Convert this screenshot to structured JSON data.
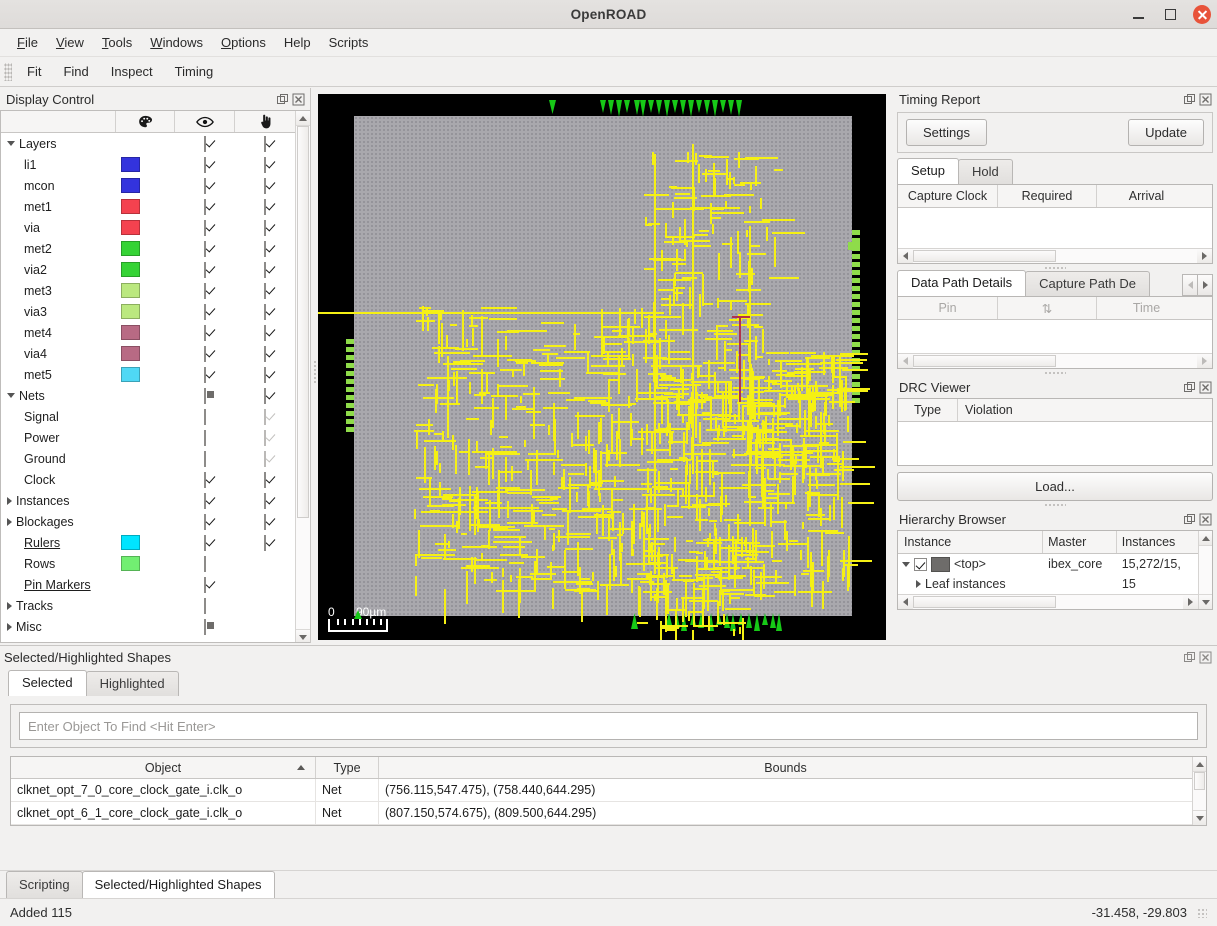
{
  "window": {
    "title": "OpenROAD",
    "minimize_label": "Minimize",
    "maximize_label": "Maximize",
    "close_label": "Close"
  },
  "menubar": {
    "items": [
      {
        "label": "File",
        "mnemonic": "F"
      },
      {
        "label": "View",
        "mnemonic": "V"
      },
      {
        "label": "Tools",
        "mnemonic": "T"
      },
      {
        "label": "Windows",
        "mnemonic": "W"
      },
      {
        "label": "Options",
        "mnemonic": "O"
      },
      {
        "label": "Help",
        "mnemonic": "H"
      },
      {
        "label": "Scripts",
        "mnemonic": ""
      }
    ]
  },
  "toolbar": {
    "items": [
      "Fit",
      "Find",
      "Inspect",
      "Timing"
    ]
  },
  "display_control": {
    "title": "Display Control",
    "columns": {
      "name": "",
      "color": "palette-icon",
      "visible": "eye-icon",
      "selectable": "pointer-hand-icon"
    },
    "rows": [
      {
        "label": "Layers",
        "indent": 0,
        "expander": "down",
        "color": null,
        "visible": "on",
        "select": "on",
        "link": false
      },
      {
        "label": "li1",
        "indent": 1,
        "expander": null,
        "color": "#3333dd",
        "visible": "on",
        "select": "on",
        "link": false
      },
      {
        "label": "mcon",
        "indent": 1,
        "expander": null,
        "color": "#3333dd",
        "visible": "on",
        "select": "on",
        "link": false
      },
      {
        "label": "met1",
        "indent": 1,
        "expander": null,
        "color": "#f4424f",
        "visible": "on",
        "select": "on",
        "link": false
      },
      {
        "label": "via",
        "indent": 1,
        "expander": null,
        "color": "#f4424f",
        "visible": "on",
        "select": "on",
        "link": false
      },
      {
        "label": "met2",
        "indent": 1,
        "expander": null,
        "color": "#35d335",
        "visible": "on",
        "select": "on",
        "link": false
      },
      {
        "label": "via2",
        "indent": 1,
        "expander": null,
        "color": "#35d335",
        "visible": "on",
        "select": "on",
        "link": false
      },
      {
        "label": "met3",
        "indent": 1,
        "expander": null,
        "color": "#bbe87f",
        "visible": "on",
        "select": "on",
        "link": false
      },
      {
        "label": "via3",
        "indent": 1,
        "expander": null,
        "color": "#bbe87f",
        "visible": "on",
        "select": "on",
        "link": false
      },
      {
        "label": "met4",
        "indent": 1,
        "expander": null,
        "color": "#b86a84",
        "visible": "on",
        "select": "on",
        "link": false
      },
      {
        "label": "via4",
        "indent": 1,
        "expander": null,
        "color": "#b86a84",
        "visible": "on",
        "select": "on",
        "link": false
      },
      {
        "label": "met5",
        "indent": 1,
        "expander": null,
        "color": "#4fd8f5",
        "visible": "on",
        "select": "on",
        "link": false
      },
      {
        "label": "Nets",
        "indent": 0,
        "expander": "down",
        "color": null,
        "visible": "partial",
        "select": "on",
        "link": false
      },
      {
        "label": "Signal",
        "indent": 1,
        "expander": null,
        "color": null,
        "visible": "off",
        "select": "on-dis",
        "link": false
      },
      {
        "label": "Power",
        "indent": 1,
        "expander": null,
        "color": null,
        "visible": "off",
        "select": "on-dis",
        "link": false
      },
      {
        "label": "Ground",
        "indent": 1,
        "expander": null,
        "color": null,
        "visible": "off",
        "select": "on-dis",
        "link": false
      },
      {
        "label": "Clock",
        "indent": 1,
        "expander": null,
        "color": null,
        "visible": "on",
        "select": "on",
        "link": false
      },
      {
        "label": "Instances",
        "indent": 0,
        "expander": "right",
        "color": null,
        "visible": "on",
        "select": "on",
        "link": false
      },
      {
        "label": "Blockages",
        "indent": 0,
        "expander": "right",
        "color": null,
        "visible": "on",
        "select": "on",
        "link": false
      },
      {
        "label": "Rulers",
        "indent": 1,
        "expander": null,
        "color": "#00e5ff",
        "visible": "on",
        "select": "on",
        "link": true
      },
      {
        "label": "Rows",
        "indent": 1,
        "expander": null,
        "color": "#72ef72",
        "visible": "off",
        "select": null,
        "link": false
      },
      {
        "label": "Pin Markers",
        "indent": 1,
        "expander": null,
        "color": null,
        "visible": "on",
        "select": null,
        "link": true
      },
      {
        "label": "Tracks",
        "indent": 0,
        "expander": "right",
        "color": null,
        "visible": "off",
        "select": null,
        "link": false
      },
      {
        "label": "Misc",
        "indent": 0,
        "expander": "right",
        "color": null,
        "visible": "partial",
        "select": null,
        "link": false
      }
    ]
  },
  "viewport": {
    "scale_zero_label": "0",
    "scale_length_label": "90µm"
  },
  "timing_report": {
    "title": "Timing Report",
    "settings_label": "Settings",
    "update_label": "Update",
    "tabs": [
      {
        "label": "Setup",
        "active": true
      },
      {
        "label": "Hold",
        "active": false
      }
    ],
    "path_columns": [
      "Capture Clock",
      "Required",
      "Arrival"
    ],
    "detail_tabs": [
      {
        "label": "Data Path Details",
        "active": true
      },
      {
        "label": "Capture Path De",
        "active": false
      }
    ],
    "detail_columns": [
      "Pin",
      "⇅",
      "Time"
    ]
  },
  "drc_viewer": {
    "title": "DRC Viewer",
    "columns": [
      "Type",
      "Violation"
    ],
    "load_label": "Load..."
  },
  "hierarchy_browser": {
    "title": "Hierarchy Browser",
    "columns": [
      "Instance",
      "Master",
      "Instances"
    ],
    "rows": [
      {
        "instance": "<top>",
        "master": "ibex_core",
        "instances": "15,272/15,",
        "expander": "down",
        "checked": true,
        "swatch": "#6e6c6a",
        "indent": 0
      },
      {
        "instance": "Leaf instances",
        "master": "",
        "instances": "15",
        "expander": "right",
        "checked": false,
        "swatch": null,
        "indent": 1
      }
    ]
  },
  "shapes_dock": {
    "title": "Selected/Highlighted Shapes",
    "tabs": [
      {
        "label": "Selected",
        "active": true
      },
      {
        "label": "Highlighted",
        "active": false
      }
    ],
    "find_placeholder": "Enter Object To Find <Hit Enter>",
    "find_value": "",
    "columns": [
      "Object",
      "Type",
      "Bounds"
    ],
    "rows": [
      {
        "object": "clknet_opt_7_0_core_clock_gate_i.clk_o",
        "type": "Net",
        "bounds": "(756.115,547.475), (758.440,644.295)"
      },
      {
        "object": "clknet_opt_6_1_core_clock_gate_i.clk_o",
        "type": "Net",
        "bounds": "(807.150,574.675), (809.500,644.295)"
      }
    ]
  },
  "bottom_tabs": [
    {
      "label": "Scripting",
      "active": false
    },
    {
      "label": "Selected/Highlighted Shapes",
      "active": true
    }
  ],
  "statusbar": {
    "message": "Added 115",
    "coordinates": "-31.458, -29.803"
  }
}
